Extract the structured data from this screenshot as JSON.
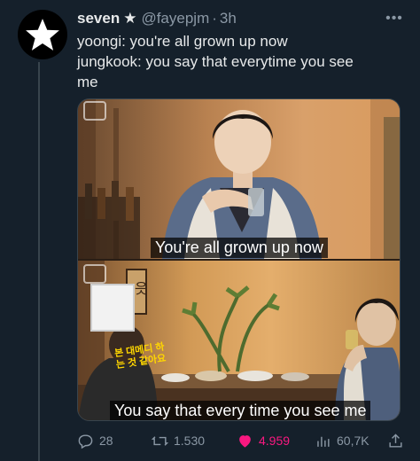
{
  "tweet": {
    "display_name": "seven",
    "verified_star": "★",
    "handle": "@fayepjm",
    "dot": "·",
    "time": "3h",
    "lines": [
      "yoongi: you're all grown up now",
      "jungkook: you say that everytime you see",
      "me"
    ]
  },
  "media": {
    "caption_top": "You're all grown up now",
    "caption_bottom": "You say that every time you see me",
    "sign_text": "읏",
    "side_text": "본 대메디 하는 것 같아요"
  },
  "actions": {
    "replies": "28",
    "retweets": "1.530",
    "likes": "4.959",
    "views": "60,7K"
  },
  "icons": {
    "avatar": "star-icon",
    "more": "more-icon",
    "reply": "reply-icon",
    "retweet": "retweet-icon",
    "like": "heart-icon",
    "views": "views-icon",
    "share": "share-icon"
  },
  "colors": {
    "background": "#15202b",
    "text": "#e7e9ea",
    "muted": "#8b98a5",
    "like": "#f91880"
  }
}
